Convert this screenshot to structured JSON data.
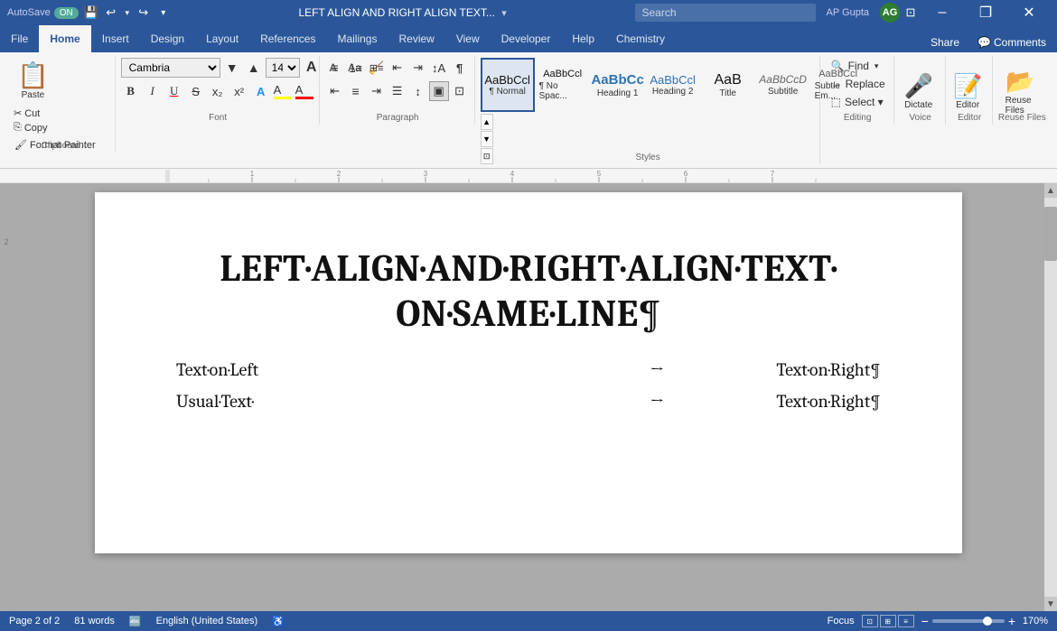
{
  "titlebar": {
    "autosave_label": "AutoSave",
    "autosave_state": "ON",
    "doc_title": "LEFT ALIGN AND RIGHT ALIGN TEXT...",
    "search_placeholder": "Search",
    "user_initials": "AG",
    "user_name": "AP Gupta",
    "btn_minimize": "–",
    "btn_restore": "❐",
    "btn_close": "✕"
  },
  "ribbon": {
    "tabs": [
      "File",
      "Home",
      "Insert",
      "Design",
      "Layout",
      "References",
      "Mailings",
      "Review",
      "View",
      "Developer",
      "Help",
      "Chemistry"
    ],
    "active_tab": "Home",
    "share_label": "Share",
    "comments_label": "Comments"
  },
  "toolbar": {
    "font_name": "Cambria",
    "font_size": "14",
    "paste_label": "Paste",
    "copy_label": "Copy",
    "cut_label": "Cut",
    "format_painter_label": "Format Painter",
    "clipboard_label": "Clipboard",
    "font_label": "Font",
    "paragraph_label": "Paragraph",
    "styles_label": "Styles",
    "editing_label": "Editing",
    "voice_label": "Voice",
    "editor_label": "Editor",
    "reuse_label": "Reuse Files",
    "dictate_label": "Dictate",
    "find_label": "Find",
    "replace_label": "Replace",
    "select_label": "Select ▾"
  },
  "styles": [
    {
      "id": "normal",
      "label": "¶ Normal",
      "class": "sty-normal"
    },
    {
      "id": "no-space",
      "label": "¶ No Spac...",
      "class": "sty-nospace"
    },
    {
      "id": "heading1",
      "label": "Heading 1",
      "class": "sty-h1"
    },
    {
      "id": "heading2",
      "label": "Heading 2",
      "class": "sty-h2"
    },
    {
      "id": "title",
      "label": "Title",
      "class": "sty-title"
    },
    {
      "id": "subtitle",
      "label": "Subtitle",
      "class": "sty-subtitle"
    },
    {
      "id": "subtle-em",
      "label": "Subtle Em...",
      "class": "sty-subtle"
    }
  ],
  "document": {
    "title_line1": "LEFT·ALIGN·AND·RIGHT·ALIGN·TEXT·",
    "title_line2": "ON·SAME·LINE¶",
    "rows": [
      {
        "left": "Text·on·Left",
        "arrow": "→",
        "right": "Text·on·Right¶"
      },
      {
        "left": "Usual·Text·",
        "arrow": "→",
        "right": "Text·on·Right¶"
      }
    ]
  },
  "status": {
    "page_info": "Page 2 of 2",
    "words": "81 words",
    "language": "English (United States)",
    "focus_label": "Focus",
    "zoom_percent": "170%",
    "zoom_value": 70
  }
}
